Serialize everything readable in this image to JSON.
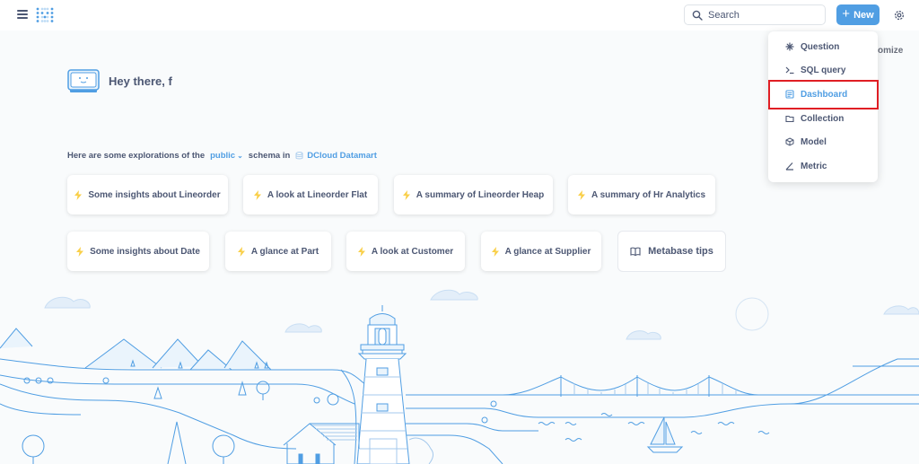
{
  "topbar": {
    "search_placeholder": "Search",
    "new_label": "New",
    "new_plus": "+"
  },
  "customize_label": "omize",
  "greeting": "Hey there, f",
  "explore": {
    "prefix": "Here are some explorations of the",
    "schema": "public",
    "chevron": "⌄",
    "middle": "schema in",
    "database": "DCloud Datamart"
  },
  "cards": [
    "Some insights about Lineorder",
    "A look at Lineorder Flat",
    "A summary of Lineorder Heap",
    "A summary of Hr Analytics",
    "Some insights about Date",
    "A glance at Part",
    "A look at Customer",
    "A glance at Supplier"
  ],
  "tips_label": "Metabase tips",
  "new_menu": {
    "items": [
      {
        "label": "Question",
        "icon": "insight-icon"
      },
      {
        "label": "SQL query",
        "icon": "sql-icon"
      },
      {
        "label": "Dashboard",
        "icon": "dashboard-icon"
      },
      {
        "label": "Collection",
        "icon": "folder-icon"
      },
      {
        "label": "Model",
        "icon": "model-icon"
      },
      {
        "label": "Metric",
        "icon": "metric-icon"
      }
    ]
  },
  "colors": {
    "brand": "#509ee3",
    "text": "#4c5773",
    "highlight": "#e01e24",
    "bolt": "#f9cf48",
    "illustration": "#509ee3"
  }
}
